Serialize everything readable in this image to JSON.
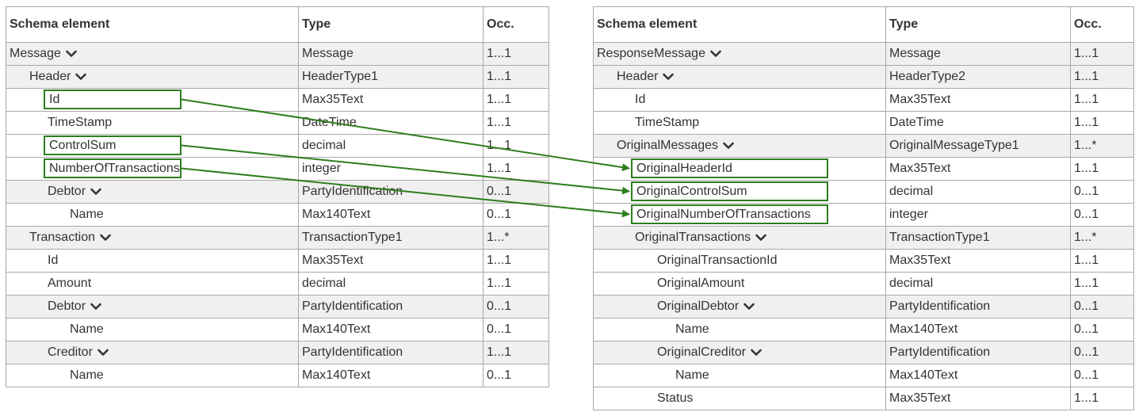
{
  "headers": {
    "element": "Schema element",
    "type": "Type",
    "occ": "Occ."
  },
  "icons": {
    "expand": "chevron-down-icon"
  },
  "colors": {
    "highlight": "#2e7d1f",
    "shade": "#f0f0f0",
    "border": "#a8a8a8"
  },
  "left_table": {
    "rows": [
      {
        "name": "Message",
        "type": "Message",
        "occ": "1...1",
        "level": 0,
        "expand": true
      },
      {
        "name": "Header",
        "type": "HeaderType1",
        "occ": "1...1",
        "level": 1,
        "expand": true
      },
      {
        "name": "Id",
        "type": "Max35Text",
        "occ": "1...1",
        "level": 2,
        "highlight": true
      },
      {
        "name": "TimeStamp",
        "type": "DateTime",
        "occ": "1...1",
        "level": 2
      },
      {
        "name": "ControlSum",
        "type": "decimal",
        "occ": "1...1",
        "level": 2,
        "highlight": true
      },
      {
        "name": "NumberOfTransactions",
        "type": "integer",
        "occ": "1...1",
        "level": 2,
        "highlight": true
      },
      {
        "name": "Debtor",
        "type": "PartyIdentification",
        "occ": "0...1",
        "level": 2,
        "expand": true
      },
      {
        "name": "Name",
        "type": "Max140Text",
        "occ": "0...1",
        "level": 3
      },
      {
        "name": "Transaction",
        "type": "TransactionType1",
        "occ": "1...*",
        "level": 1,
        "expand": true
      },
      {
        "name": "Id",
        "type": "Max35Text",
        "occ": "1...1",
        "level": 2
      },
      {
        "name": "Amount",
        "type": "decimal",
        "occ": "1...1",
        "level": 2
      },
      {
        "name": "Debtor",
        "type": "PartyIdentification",
        "occ": "0...1",
        "level": 2,
        "expand": true
      },
      {
        "name": "Name",
        "type": "Max140Text",
        "occ": "0...1",
        "level": 3
      },
      {
        "name": "Creditor",
        "type": "PartyIdentification",
        "occ": "1...1",
        "level": 2,
        "expand": true
      },
      {
        "name": "Name",
        "type": "Max140Text",
        "occ": "0...1",
        "level": 3
      }
    ]
  },
  "right_table": {
    "rows": [
      {
        "name": "ResponseMessage",
        "type": "Message",
        "occ": "1...1",
        "level": 0,
        "expand": true
      },
      {
        "name": "Header",
        "type": "HeaderType2",
        "occ": "1...1",
        "level": 1,
        "expand": true
      },
      {
        "name": "Id",
        "type": "Max35Text",
        "occ": "1...1",
        "level": 2
      },
      {
        "name": "TimeStamp",
        "type": "DateTime",
        "occ": "1...1",
        "level": 2
      },
      {
        "name": "OriginalMessages",
        "type": "OriginalMessageType1",
        "occ": "1...*",
        "level": 1,
        "expand": true
      },
      {
        "name": "OriginalHeaderId",
        "type": "Max35Text",
        "occ": "1...1",
        "level": 2,
        "highlight": true
      },
      {
        "name": "OriginalControlSum",
        "type": "decimal",
        "occ": "0...1",
        "level": 2,
        "highlight": true
      },
      {
        "name": "OriginalNumberOfTransactions",
        "type": "integer",
        "occ": "0...1",
        "level": 2,
        "highlight": true
      },
      {
        "name": "OriginalTransactions",
        "type": "TransactionType1",
        "occ": "1...*",
        "level": 2,
        "expand": true
      },
      {
        "name": "OriginalTransactionId",
        "type": "Max35Text",
        "occ": "1...1",
        "level": 3
      },
      {
        "name": "OriginalAmount",
        "type": "decimal",
        "occ": "1...1",
        "level": 3
      },
      {
        "name": "OriginalDebtor",
        "type": "PartyIdentification",
        "occ": "0...1",
        "level": 3,
        "expand": true
      },
      {
        "name": "Name",
        "type": "Max140Text",
        "occ": "0...1",
        "level": 4
      },
      {
        "name": "OriginalCreditor",
        "type": "PartyIdentification",
        "occ": "0...1",
        "level": 3,
        "expand": true
      },
      {
        "name": "Name",
        "type": "Max140Text",
        "occ": "0...1",
        "level": 4
      },
      {
        "name": "Status",
        "type": "Max35Text",
        "occ": "1...1",
        "level": 3
      }
    ]
  },
  "mappings": [
    {
      "from": "Id",
      "to": "OriginalHeaderId"
    },
    {
      "from": "ControlSum",
      "to": "OriginalControlSum"
    },
    {
      "from": "NumberOfTransactions",
      "to": "OriginalNumberOfTransactions"
    }
  ]
}
